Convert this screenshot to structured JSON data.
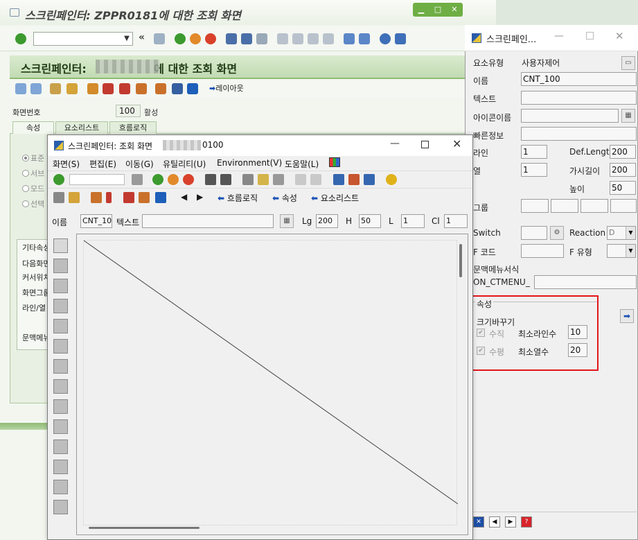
{
  "bg_window": {
    "title_prefix": "스크린페인터: ",
    "title_program": "ZPPR0181",
    "title_suffix": "에 대한 조회 화면",
    "window_buttons": [
      "▁",
      "□",
      "✕"
    ],
    "header_title_prefix": "스크린페인터: ",
    "header_title_suffix": "에 대한 조회 화면",
    "layout_button": "레이아웃",
    "screen_number_label": "화면번호",
    "screen_number_value": "100",
    "screen_status": "활성",
    "tabs": [
      "속성",
      "요소리스트",
      "흐름로직"
    ],
    "radio_options": [
      "표준",
      "서브",
      "모드",
      "선택"
    ],
    "other_attributes": [
      "기타속성",
      "다음화면",
      "커서위치",
      "화면그룹",
      "라인/열",
      "문맥메뉴"
    ]
  },
  "screen_painter": {
    "title_prefix": "스크린페인터: 조회 화면",
    "title_suffix": "0100",
    "menu": [
      "화면(S)",
      "편집(E)",
      "이동(G)",
      "유틸리티(U)",
      "Environment(V)",
      "도움말(L)"
    ],
    "toolbar2_labels": [
      "흐름로직",
      "속성",
      "요소리스트"
    ],
    "fields": {
      "name_label": "이름",
      "name_value": "CNT_10",
      "text_label": "텍스트",
      "text_value": "",
      "lg_label": "Lg",
      "lg_value": "200",
      "h_label": "H",
      "h_value": "50",
      "l_label": "L",
      "l_value": "1",
      "c_label": "Cl",
      "c_value": "1"
    }
  },
  "properties": {
    "title": "스크린페인...",
    "element_type_label": "요소유형",
    "element_type_value": "사용자제어",
    "name_label": "이름",
    "name_value": "CNT_100",
    "text_label": "텍스트",
    "text_value": "",
    "icon_name_label": "아이콘이름",
    "icon_name_value": "",
    "quick_info_label": "빠른정보",
    "quick_info_value": "",
    "line_label": "라인",
    "line_value": "1",
    "def_length_label": "Def.Length",
    "def_length_value": "200",
    "column_label": "열",
    "column_value": "1",
    "visible_length_label": "가시길이",
    "visible_length_value": "200",
    "height_label": "높이",
    "height_value": "50",
    "group_label": "그룹",
    "switch_label": "Switch",
    "reaction_label": "Reaction",
    "reaction_value": "D",
    "f_code_label": "F 코드",
    "f_type_label": "F 유형",
    "context_menu_label": "문맥메뉴서식",
    "context_menu_value": "ON_CTMENU_",
    "attributes_group_label": "속성",
    "resize_label": "크기바꾸기",
    "vertical_label": "수직",
    "min_lines_label": "최소라인수",
    "min_lines_value": "10",
    "horizontal_label": "수평",
    "min_columns_label": "최소열수",
    "min_columns_value": "20"
  },
  "colors": {
    "sap_green": "#8fbb74",
    "highlight_red": "#e5141b",
    "nav_blue": "#1a52b5"
  }
}
